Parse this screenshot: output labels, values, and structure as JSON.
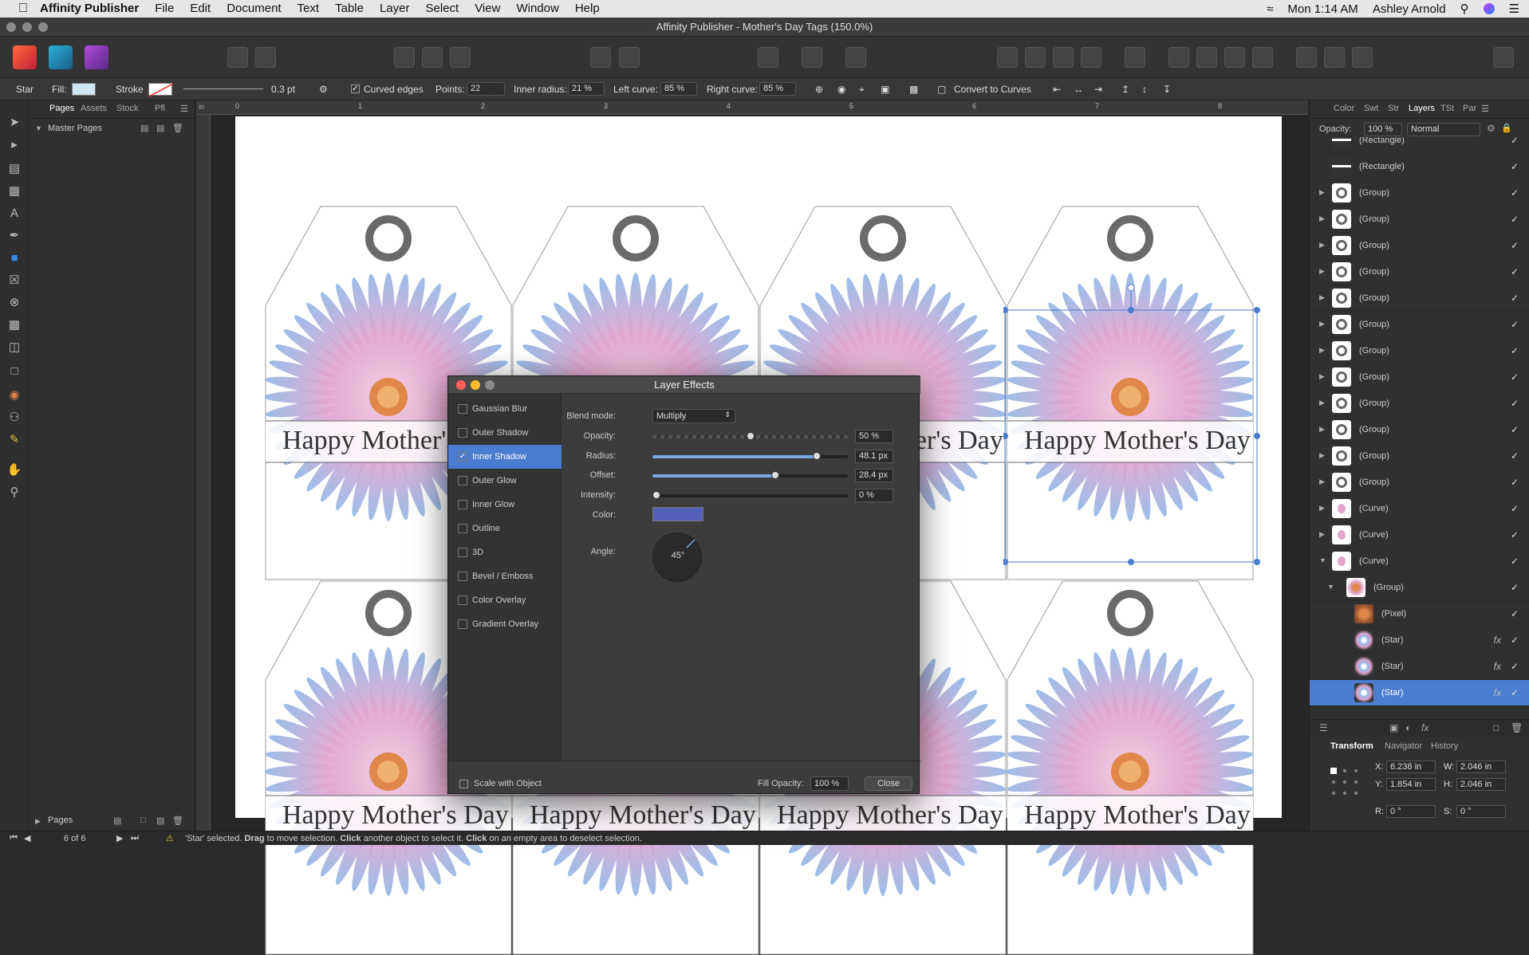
{
  "menubar": {
    "app_name": "Affinity Publisher",
    "items": [
      "File",
      "Edit",
      "Document",
      "Text",
      "Table",
      "Layer",
      "Select",
      "View",
      "Window",
      "Help"
    ],
    "clock": "Mon 1:14 AM",
    "user": "Ashley Arnold"
  },
  "window": {
    "title": "Affinity Publisher - Mother's Day Tags (150.0%)"
  },
  "context": {
    "tool_name": "Star",
    "fill_label": "Fill:",
    "stroke_label": "Stroke",
    "stroke_width": "0.3 pt",
    "curved_edges_label": "Curved edges",
    "curved_edges_checked": "✓",
    "points_label": "Points:",
    "points_value": "22",
    "inner_radius_label": "Inner radius:",
    "inner_radius_value": "21 %",
    "left_curve_label": "Left curve:",
    "left_curve_value": "85 %",
    "right_curve_label": "Right curve:",
    "right_curve_value": "85 %",
    "convert_label": "Convert to Curves",
    "fill_color": "#cfe7f5"
  },
  "pages_panel": {
    "tabs": [
      "Pages",
      "Assets",
      "Stock",
      "Pfl"
    ],
    "master_pages_label": "Master Pages",
    "pages_label": "Pages",
    "page_counter": "6 of 6"
  },
  "canvas": {
    "tag_text": "Happy Mother's Day",
    "tag_text_partial_left": "Happy Mother's",
    "tag_text_partial_right": "'s Day",
    "ruler_marks": [
      "0",
      "1",
      "2",
      "3",
      "4",
      "5",
      "6",
      "7",
      "8"
    ],
    "ruler_unit": "in"
  },
  "dialog": {
    "title": "Layer Effects",
    "effects": [
      {
        "label": "Gaussian Blur",
        "checked": ""
      },
      {
        "label": "Outer Shadow",
        "checked": ""
      },
      {
        "label": "Inner Shadow",
        "checked": "✓"
      },
      {
        "label": "Outer Glow",
        "checked": ""
      },
      {
        "label": "Inner Glow",
        "checked": ""
      },
      {
        "label": "Outline",
        "checked": ""
      },
      {
        "label": "3D",
        "checked": ""
      },
      {
        "label": "Bevel / Emboss",
        "checked": ""
      },
      {
        "label": "Color Overlay",
        "checked": ""
      },
      {
        "label": "Gradient Overlay",
        "checked": ""
      }
    ],
    "blend_mode_label": "Blend mode:",
    "blend_mode_value": "Multiply",
    "opacity_label": "Opacity:",
    "opacity_value": "50 %",
    "opacity_fraction": 0.5,
    "radius_label": "Radius:",
    "radius_value": "48.1 px",
    "radius_fraction": 0.84,
    "offset_label": "Offset:",
    "offset_value": "28.4 px",
    "offset_fraction": 0.63,
    "intensity_label": "Intensity:",
    "intensity_value": "0 %",
    "intensity_fraction": 0.02,
    "color_label": "Color:",
    "shadow_color": "#5560b8",
    "angle_label": "Angle:",
    "angle_value": "45°",
    "scale_label": "Scale with Object",
    "fill_opacity_label": "Fill Opacity:",
    "fill_opacity_value": "100 %",
    "close_label": "Close"
  },
  "right_panel": {
    "tabs": [
      "Color",
      "Swt",
      "Str",
      "Layers",
      "TSt",
      "Par"
    ],
    "opacity_label": "Opacity:",
    "opacity_value": "100 %",
    "blend_value": "Normal",
    "layers": [
      {
        "name": "(Rectangle)",
        "expand": "",
        "fx": "",
        "thumb": "rect"
      },
      {
        "name": "(Rectangle)",
        "expand": "",
        "fx": "",
        "thumb": "rect"
      },
      {
        "name": "(Group)",
        "expand": "▶",
        "fx": "",
        "thumb": "ring"
      },
      {
        "name": "(Group)",
        "expand": "▶",
        "fx": "",
        "thumb": "ring"
      },
      {
        "name": "(Group)",
        "expand": "▶",
        "fx": "",
        "thumb": "ring"
      },
      {
        "name": "(Group)",
        "expand": "▶",
        "fx": "",
        "thumb": "ring"
      },
      {
        "name": "(Group)",
        "expand": "▶",
        "fx": "",
        "thumb": "ring"
      },
      {
        "name": "(Group)",
        "expand": "▶",
        "fx": "",
        "thumb": "ring"
      },
      {
        "name": "(Group)",
        "expand": "▶",
        "fx": "",
        "thumb": "ring"
      },
      {
        "name": "(Group)",
        "expand": "▶",
        "fx": "",
        "thumb": "ring"
      },
      {
        "name": "(Group)",
        "expand": "▶",
        "fx": "",
        "thumb": "ring"
      },
      {
        "name": "(Group)",
        "expand": "▶",
        "fx": "",
        "thumb": "ring"
      },
      {
        "name": "(Group)",
        "expand": "▶",
        "fx": "",
        "thumb": "ring"
      },
      {
        "name": "(Group)",
        "expand": "▶",
        "fx": "",
        "thumb": "ring"
      },
      {
        "name": "(Curve)",
        "expand": "▶",
        "fx": "",
        "thumb": "tag"
      },
      {
        "name": "(Curve)",
        "expand": "▶",
        "fx": "",
        "thumb": "tag"
      },
      {
        "name": "(Curve)",
        "expand": "▼",
        "fx": "",
        "thumb": "tag"
      },
      {
        "name": "(Group)",
        "expand": "▼",
        "fx": "",
        "thumb": "flower",
        "indent": 1
      },
      {
        "name": "(Pixel)",
        "expand": "",
        "fx": "",
        "thumb": "pixel",
        "indent": 2
      },
      {
        "name": "(Star)",
        "expand": "",
        "fx": "fx",
        "thumb": "star",
        "indent": 2
      },
      {
        "name": "(Star)",
        "expand": "",
        "fx": "fx",
        "thumb": "star",
        "indent": 2
      },
      {
        "name": "(Star)",
        "expand": "",
        "fx": "fx",
        "thumb": "star",
        "indent": 2,
        "selected": true
      }
    ],
    "bottom_tabs": [
      "Transform",
      "Navigator",
      "History"
    ],
    "transform": {
      "x_label": "X:",
      "x": "6.238 in",
      "y_label": "Y:",
      "y": "1.854 in",
      "w_label": "W:",
      "w": "2.046 in",
      "h_label": "H:",
      "h": "2.046 in",
      "r_label": "R:",
      "r": "0 °",
      "s_label": "S:",
      "s": "0 °"
    }
  },
  "status": {
    "message_pre": "'Star' selected. ",
    "drag": "Drag",
    "msg2": " to move selection. ",
    "click": "Click",
    "msg3": " another object to select it. ",
    "click2": "Click",
    "msg4": " on an empty area to deselect selection."
  },
  "colors": {
    "accent": "#4a7ccf",
    "petal_pink": "#e2a6cf",
    "petal_blue": "#8fb6e6",
    "center_orange": "#e0874a"
  }
}
